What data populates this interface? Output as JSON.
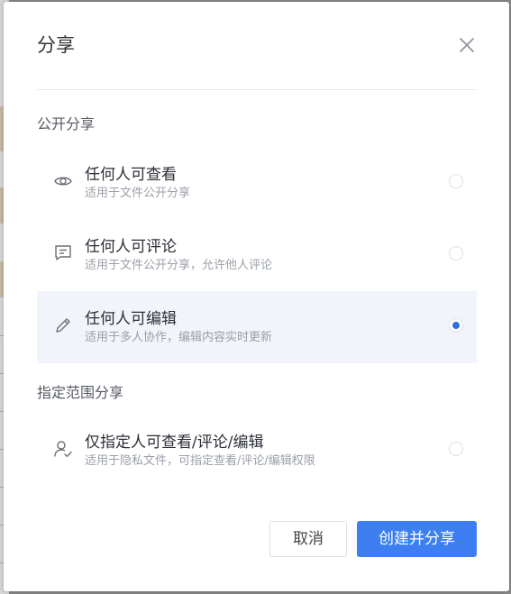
{
  "dialog": {
    "title": "分享"
  },
  "sections": {
    "public": {
      "label": "公开分享"
    },
    "scoped": {
      "label": "指定范围分享"
    }
  },
  "options": [
    {
      "title": "任何人可查看",
      "desc": "适用于文件公开分享",
      "icon": "eye-icon",
      "selected": false
    },
    {
      "title": "任何人可评论",
      "desc": "适用于文件公开分享，允许他人评论",
      "icon": "comment-icon",
      "selected": false
    },
    {
      "title": "任何人可编辑",
      "desc": "适用于多人协作，编辑内容实时更新",
      "icon": "pencil-icon",
      "selected": true
    },
    {
      "title": "仅指定人可查看/评论/编辑",
      "desc": "适用于隐私文件，可指定查看/评论/编辑权限",
      "icon": "user-check-icon",
      "selected": false
    }
  ],
  "footer": {
    "cancel_label": "取消",
    "confirm_label": "创建并分享"
  },
  "colors": {
    "accent": "#3d7ef0",
    "radio_dot": "#2f6fe0",
    "selected_row_bg": "#f1f4fa"
  }
}
